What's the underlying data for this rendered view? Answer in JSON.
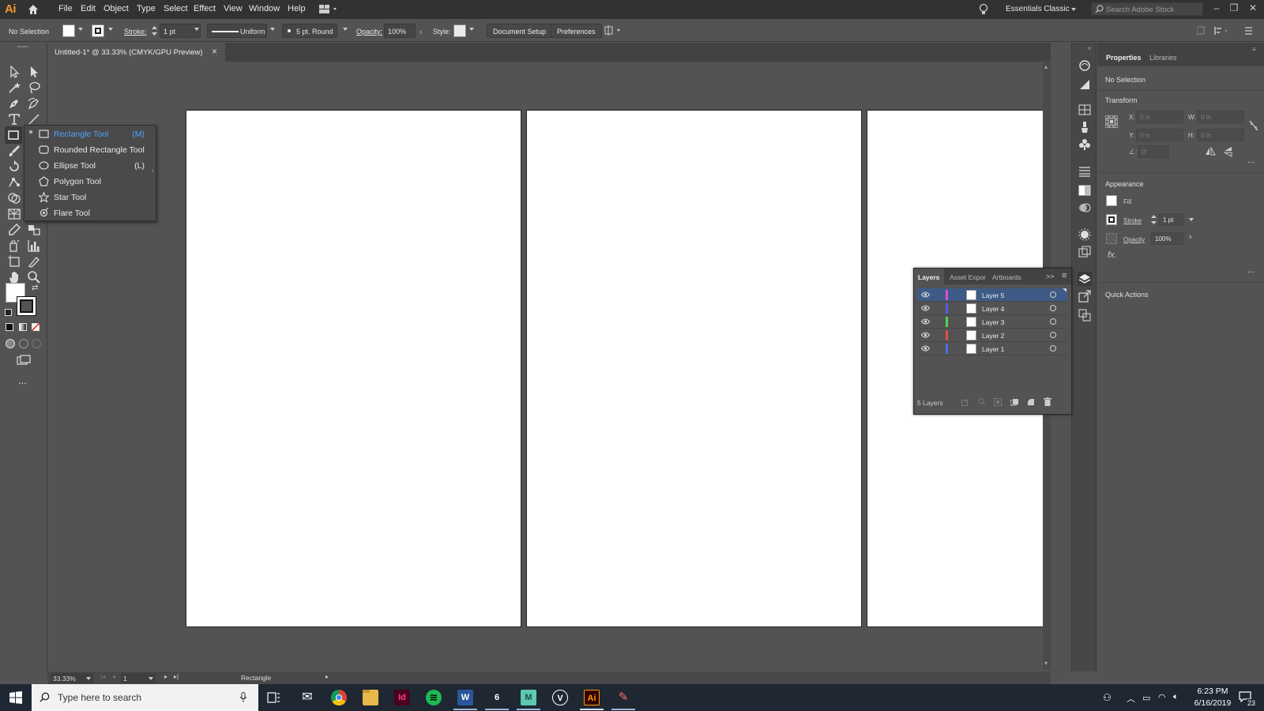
{
  "app": {
    "logo": "Ai",
    "menu": [
      "File",
      "Edit",
      "Object",
      "Type",
      "Select",
      "Effect",
      "View",
      "Window",
      "Help"
    ],
    "workspace": "Essentials Classic",
    "search_placeholder": "Search Adobe Stock"
  },
  "control_bar": {
    "selection": "No Selection",
    "stroke_label": "Stroke:",
    "stroke_value": "1 pt",
    "stroke_profile": "Uniform",
    "brush": "5 pt. Round",
    "opacity_label": "Opacity:",
    "opacity_value": "100%",
    "style_label": "Style:",
    "document_setup": "Document Setup",
    "preferences": "Preferences"
  },
  "document": {
    "tab_title": "Untitled-1* @ 33.33% (CMYK/GPU Preview)",
    "close": "×"
  },
  "flyout": [
    {
      "label": "Rectangle Tool",
      "shortcut": "(M)",
      "icon": "rectangle-icon",
      "active": true
    },
    {
      "label": "Rounded Rectangle Tool",
      "shortcut": "",
      "icon": "rounded-rectangle-icon",
      "active": false
    },
    {
      "label": "Ellipse Tool",
      "shortcut": "(L)",
      "icon": "ellipse-icon",
      "active": false
    },
    {
      "label": "Polygon Tool",
      "shortcut": "",
      "icon": "polygon-icon",
      "active": false
    },
    {
      "label": "Star Tool",
      "shortcut": "",
      "icon": "star-icon",
      "active": false
    },
    {
      "label": "Flare Tool",
      "shortcut": "",
      "icon": "flare-icon",
      "active": false
    }
  ],
  "toolbar": {
    "more": "..."
  },
  "status_bar": {
    "zoom": "33.33%",
    "artboard_number": "1",
    "current_tool": "Rectangle"
  },
  "properties_panel": {
    "tabs": [
      "Properties",
      "Libraries"
    ],
    "selection": "No Selection",
    "transform_title": "Transform",
    "x_label": "X:",
    "y_label": "Y:",
    "w_label": "W:",
    "h_label": "H:",
    "x_value": "0 in",
    "y_value": "0 in",
    "w_value": "0 in",
    "h_value": "0 in",
    "angle_value": "0°",
    "appearance_title": "Appearance",
    "fill_label": "Fill",
    "stroke_label": "Stroke",
    "stroke_value": "1 pt",
    "opacity_label": "Opacity",
    "opacity_value": "100%",
    "fx_label": "fx.",
    "quick_actions": "Quick Actions",
    "more": "..."
  },
  "layers_panel": {
    "tabs": [
      "Layers",
      "Asset Expor",
      "Artboards"
    ],
    "collapse": ">>",
    "layers": [
      {
        "name": "Layer 5",
        "color": "#e24bd6",
        "selected": true
      },
      {
        "name": "Layer 4",
        "color": "#5a5ae6",
        "selected": false
      },
      {
        "name": "Layer 3",
        "color": "#4fd64f",
        "selected": false
      },
      {
        "name": "Layer 2",
        "color": "#e64b4b",
        "selected": false
      },
      {
        "name": "Layer 1",
        "color": "#4b6fe6",
        "selected": false
      }
    ],
    "count": "5 Layers"
  },
  "taskbar": {
    "search_placeholder": "Type here to search",
    "apps": [
      {
        "name": "mail",
        "label": "✉",
        "bg": "#1f2733",
        "fg": "#ffffff"
      },
      {
        "name": "chrome",
        "label": "◉",
        "bg": "#1f2733",
        "fg": "#e8b33a"
      },
      {
        "name": "file-explorer",
        "label": "▬",
        "bg": "#e6b94a",
        "fg": "#8a6a1e"
      },
      {
        "name": "indesign",
        "label": "Id",
        "bg": "#49021f",
        "fg": "#ff3d8b"
      },
      {
        "name": "spotify",
        "label": "≋",
        "bg": "#1db954",
        "fg": "#000000"
      },
      {
        "name": "word",
        "label": "W",
        "bg": "#2b579a",
        "fg": "#ffffff"
      },
      {
        "name": "rhino",
        "label": "6",
        "bg": "#1f2733",
        "fg": "#ffffff"
      },
      {
        "name": "m-app",
        "label": "M",
        "bg": "#5fc7b4",
        "fg": "#1f4f47"
      },
      {
        "name": "vectorworks",
        "label": "V",
        "bg": "#1f2733",
        "fg": "#ffffff"
      },
      {
        "name": "illustrator",
        "label": "Ai",
        "bg": "#330000",
        "fg": "#ff9a00"
      },
      {
        "name": "paint-app",
        "label": "✎",
        "bg": "#1f2733",
        "fg": "#ff6b6b"
      }
    ],
    "time": "6:23 PM",
    "date": "6/16/2019",
    "notifications": "23"
  },
  "colors": {
    "accent": "#3e5a86",
    "flyout_active": "#4fa3ff",
    "illustrator_orange": "#f29a2e"
  }
}
